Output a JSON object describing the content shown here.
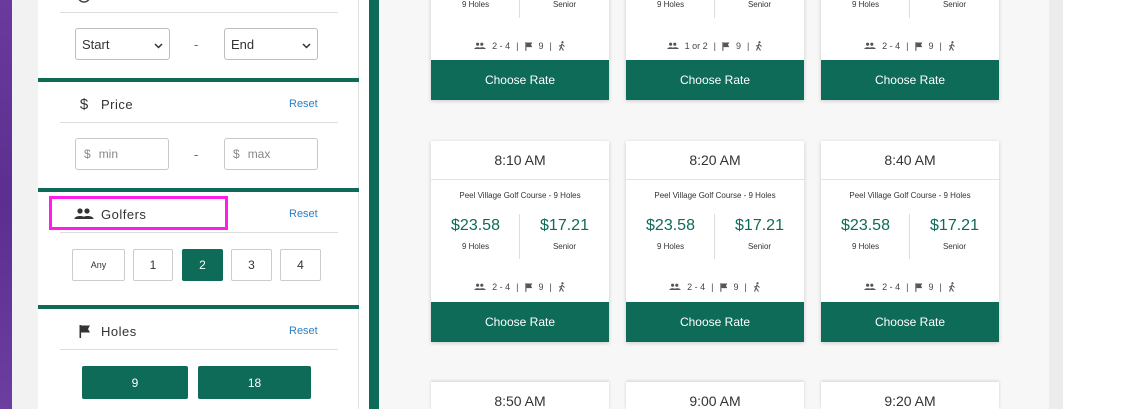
{
  "sidebar": {
    "time": {
      "start": "Start",
      "end": "End",
      "dash": "-"
    },
    "price": {
      "title": "Price",
      "reset": "Reset",
      "min_placeholder": "min",
      "max_placeholder": "max",
      "currency": "$",
      "dash": "-"
    },
    "golfers": {
      "title": "Golfers",
      "reset": "Reset",
      "options": [
        "Any",
        "1",
        "2",
        "3",
        "4"
      ],
      "selected": "2"
    },
    "holes": {
      "title": "Holes",
      "reset": "Reset",
      "options": [
        "9",
        "18"
      ]
    }
  },
  "top_cards": [
    {
      "sub1": "9 Holes",
      "sub2": "Senior",
      "players": "2 - 4",
      "holes": "9",
      "rate_label": "Choose Rate"
    },
    {
      "sub1": "9 Holes",
      "sub2": "Senior",
      "players": "1 or 2",
      "holes": "9",
      "rate_label": "Choose Rate"
    },
    {
      "sub1": "9 Holes",
      "sub2": "Senior",
      "players": "2 - 4",
      "holes": "9",
      "rate_label": "Choose Rate"
    }
  ],
  "cards": [
    {
      "time": "8:10 AM",
      "course": "Peel Village Golf Course - 9 Holes",
      "price1": "$23.58",
      "sub1": "9 Holes",
      "price2": "$17.21",
      "sub2": "Senior",
      "players": "2 - 4",
      "holes": "9",
      "rate_label": "Choose Rate"
    },
    {
      "time": "8:20 AM",
      "course": "Peel Village Golf Course - 9 Holes",
      "price1": "$23.58",
      "sub1": "9 Holes",
      "price2": "$17.21",
      "sub2": "Senior",
      "players": "2 - 4",
      "holes": "9",
      "rate_label": "Choose Rate"
    },
    {
      "time": "8:40 AM",
      "course": "Peel Village Golf Course - 9 Holes",
      "price1": "$23.58",
      "sub1": "9 Holes",
      "price2": "$17.21",
      "sub2": "Senior",
      "players": "2 - 4",
      "holes": "9",
      "rate_label": "Choose Rate"
    }
  ],
  "bottom_cards": [
    {
      "time": "8:50 AM"
    },
    {
      "time": "9:00 AM"
    },
    {
      "time": "9:20 AM"
    }
  ],
  "meta_sep": "|",
  "colors": {
    "accent": "#0d6b58",
    "highlight": "#ff1ee8",
    "link": "#2a7fc4"
  }
}
